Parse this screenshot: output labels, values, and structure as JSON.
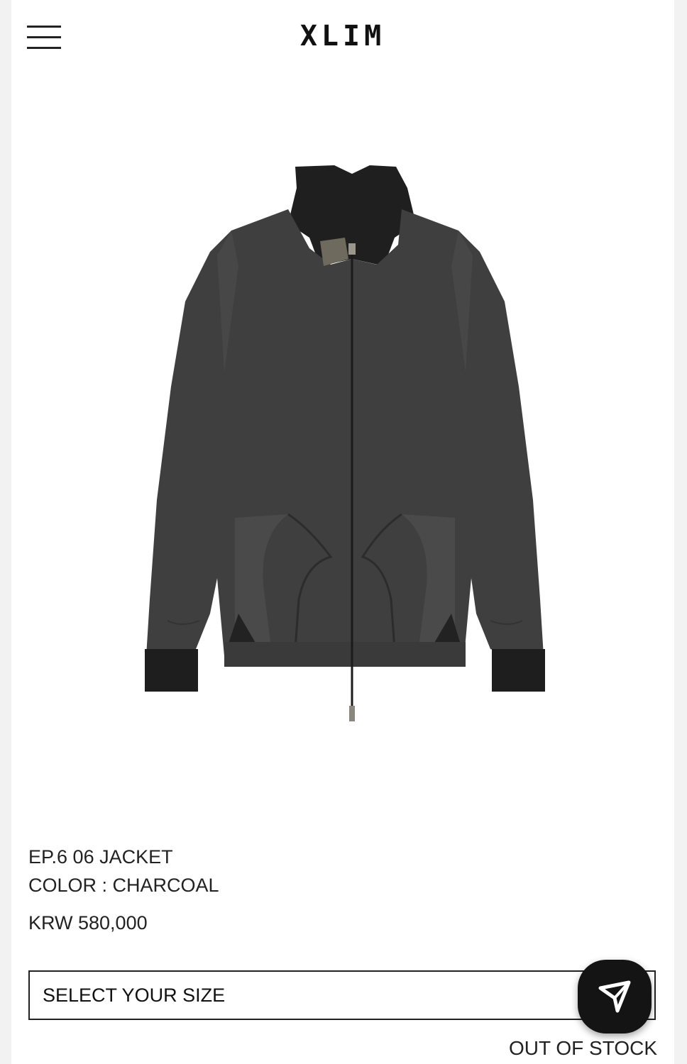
{
  "header": {
    "logo": "XLIM",
    "menu_icon": "hamburger-menu-icon"
  },
  "product": {
    "name": "EP.6 06 JACKET",
    "color_line": "COLOR : CHARCOAL",
    "price": "KRW 580,000",
    "image": "charcoal-zip-jacket-image",
    "jacket_color": "#3f3f3f",
    "rib_color": "#1e1e1e"
  },
  "size_select": {
    "label": "SELECT YOUR SIZE"
  },
  "stock_status": "OUT OF STOCK",
  "fab": {
    "icon": "send-arrow-icon"
  }
}
